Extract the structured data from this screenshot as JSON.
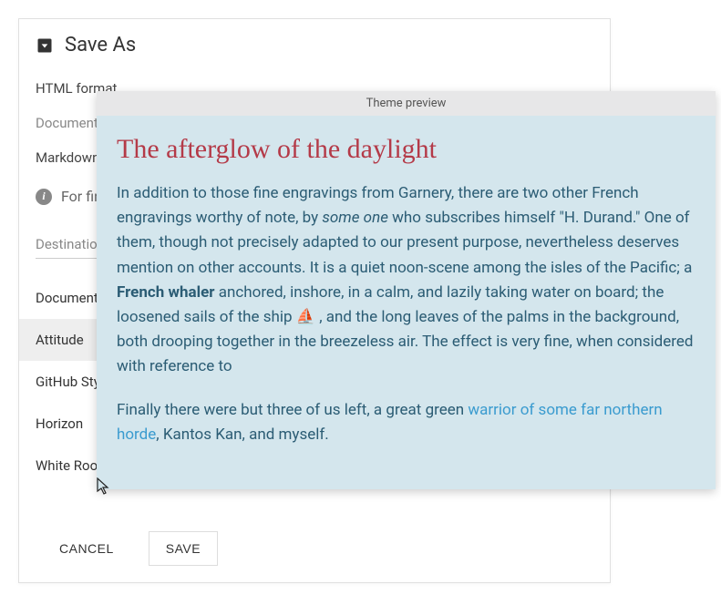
{
  "dialog": {
    "title": "Save As",
    "rows": {
      "html_format": "HTML format",
      "doc_title": "Document Title",
      "markdown": "Markdown",
      "info": "For final"
    },
    "destination_label": "Destination",
    "themes": [
      {
        "label": "Document"
      },
      {
        "label": "Attitude"
      },
      {
        "label": "GitHub Style"
      },
      {
        "label": "Horizon"
      },
      {
        "label": "White Room"
      }
    ],
    "buttons": {
      "cancel": "CANCEL",
      "save": "SAVE"
    }
  },
  "preview": {
    "header": "Theme preview",
    "title": "The afterglow of the daylight",
    "para1_pre": "In addition to those fine engravings from Garnery, there are two other French engravings worthy of note, by ",
    "para1_em": "some one",
    "para1_mid": " who subscribes himself \"H. Durand.\" One of them, though not precisely adapted to our present purpose, nevertheless deserves mention on other accounts. It is a quiet noon-scene among the isles of the Pacific; a ",
    "para1_strong": "French whaler",
    "para1_post1": " anchored, inshore, in a calm, and lazily taking water on board; the loosened sails of the ship ",
    "para1_emoji": "⛵",
    "para1_post2": " , and the long leaves of the palms in the background, both drooping together in the breezeless air. The effect is very fine, when considered with reference to",
    "para2_pre": "Finally there were but three of us left, a great green ",
    "para2_link": "warrior of some far northern horde",
    "para2_post": ", Kantos Kan, and myself."
  }
}
